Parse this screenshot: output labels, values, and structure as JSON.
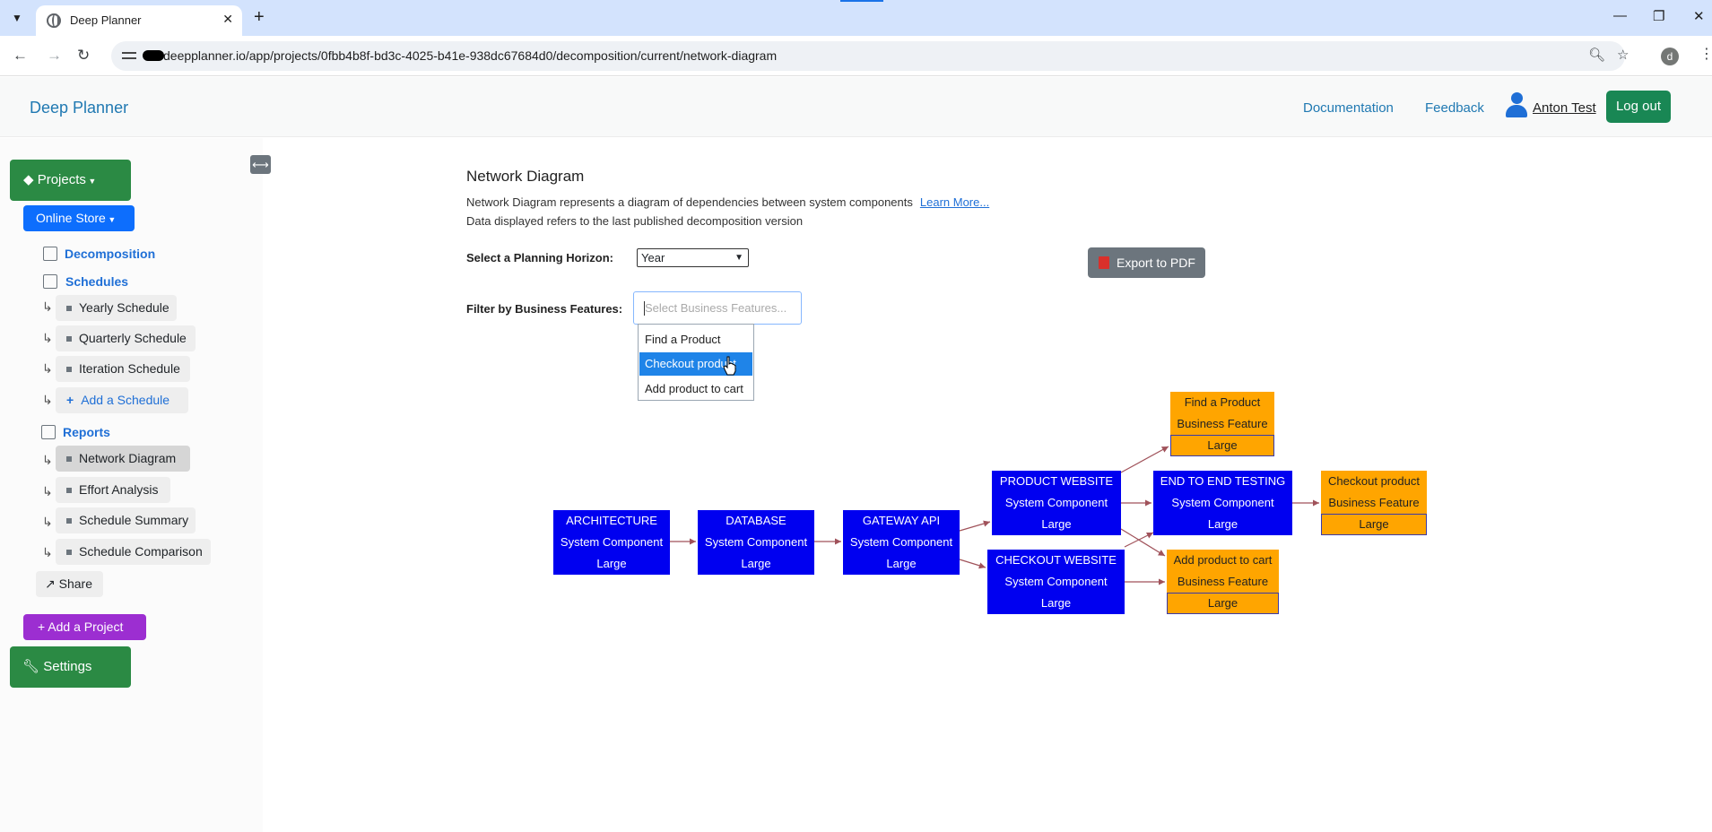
{
  "browser": {
    "tab_title": "Deep Planner",
    "url": "deepplanner.io/app/projects/0fbb4b8f-bd3c-4025-b41e-938dc67684d0/decomposition/current/network-diagram",
    "profile_initial": "d",
    "icons": [
      "tab-search-icon",
      "globe-icon",
      "close-icon",
      "plus-icon",
      "minimize-icon",
      "restore-icon",
      "close-window-icon",
      "back-icon",
      "forward-icon",
      "reload-icon",
      "site-info-icon",
      "zoom-icon",
      "star-icon",
      "kebab-menu-icon"
    ]
  },
  "navbar": {
    "brand": "Deep Planner",
    "links": {
      "documentation": "Documentation",
      "feedback": "Feedback"
    },
    "user_name": "Anton Test",
    "logout": "Log out"
  },
  "sidebar": {
    "projects_label": "Projects",
    "project_name": "Online Store",
    "decomposition": "Decomposition",
    "schedules": "Schedules",
    "schedule_items": [
      "Yearly Schedule",
      "Quarterly Schedule",
      "Iteration Schedule"
    ],
    "add_schedule": "Add a Schedule",
    "reports": "Reports",
    "report_items": [
      "Network Diagram",
      "Effort Analysis",
      "Schedule Summary",
      "Schedule Comparison"
    ],
    "active_report": "Network Diagram",
    "share": "Share",
    "add_project": "Add a Project",
    "settings": "Settings"
  },
  "main": {
    "title": "Network Diagram",
    "description": "Network Diagram represents a diagram of dependencies between system components",
    "learn_more": "Learn More...",
    "data_note": "Data displayed refers to the last published decomposition version",
    "horizon_label": "Select a Planning Horizon:",
    "horizon_value": "Year",
    "export_label": "Export to PDF",
    "filter_label": "Filter by Business Features:",
    "filter_placeholder": "Select Business Features...",
    "dropdown_options": [
      "Find a Product",
      "Checkout product",
      "Add product to cart"
    ],
    "dropdown_selected": "Checkout product"
  },
  "diagram": {
    "colors": {
      "system": "#0000f0",
      "feature": "#ffa500",
      "edge": "#a0525a"
    },
    "nodes": [
      {
        "id": "architecture",
        "name": "ARCHITECTURE",
        "type": "System Component",
        "size": "Large"
      },
      {
        "id": "database",
        "name": "DATABASE",
        "type": "System Component",
        "size": "Large"
      },
      {
        "id": "gateway",
        "name": "GATEWAY API",
        "type": "System Component",
        "size": "Large"
      },
      {
        "id": "product_site",
        "name": "PRODUCT WEBSITE",
        "type": "System Component",
        "size": "Large"
      },
      {
        "id": "checkout_site",
        "name": "CHECKOUT WEBSITE",
        "type": "System Component",
        "size": "Large"
      },
      {
        "id": "e2e",
        "name": "END TO END TESTING",
        "type": "System Component",
        "size": "Large"
      },
      {
        "id": "find",
        "name": "Find a Product",
        "type": "Business Feature",
        "size": "Large"
      },
      {
        "id": "checkout",
        "name": "Checkout product",
        "type": "Business Feature",
        "size": "Large"
      },
      {
        "id": "addcart",
        "name": "Add product to cart",
        "type": "Business Feature",
        "size": "Large"
      }
    ]
  }
}
